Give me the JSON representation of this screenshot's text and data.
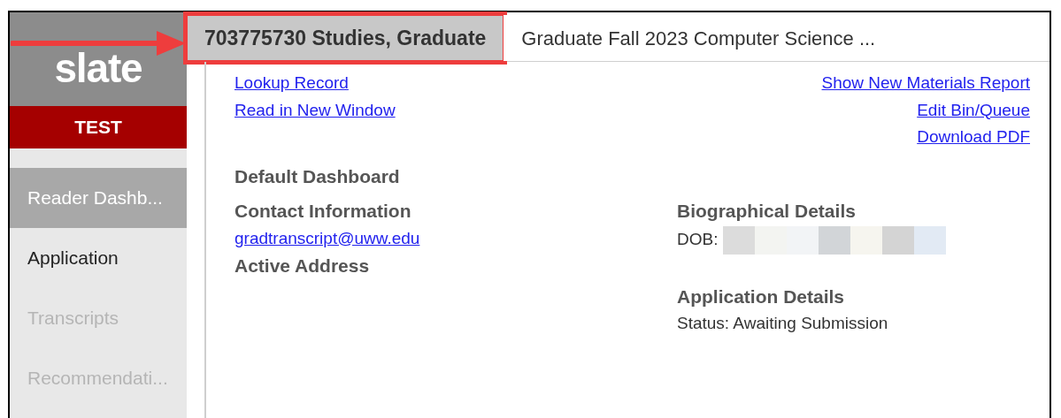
{
  "sidebar": {
    "logo": "slate",
    "badge": "TEST",
    "items": [
      {
        "label": "Reader Dashb...",
        "selected": true,
        "disabled": false
      },
      {
        "label": "Application",
        "selected": false,
        "disabled": false
      },
      {
        "label": "Transcripts",
        "selected": false,
        "disabled": true
      },
      {
        "label": "Recommendati...",
        "selected": false,
        "disabled": true
      }
    ]
  },
  "tabs": [
    {
      "label": "703775730 Studies, Graduate",
      "selected": true,
      "highlighted": true
    },
    {
      "label": "Graduate Fall 2023 Computer Science ...",
      "selected": false,
      "highlighted": false
    }
  ],
  "annotations": [
    {
      "kind": "arrow"
    }
  ],
  "links_left": [
    "Lookup Record",
    "Read in New Window"
  ],
  "links_right": [
    "Show New Materials Report",
    "Edit Bin/Queue",
    "Download PDF"
  ],
  "dashboard_title": "Default Dashboard",
  "left_column": [
    {
      "kind": "heading",
      "text": "Contact Information"
    },
    {
      "kind": "link",
      "text": "gradtranscript@uww.edu"
    },
    {
      "kind": "heading",
      "text": "Active Address"
    }
  ],
  "right_column": [
    {
      "kind": "heading",
      "text": "Biographical Details"
    },
    {
      "kind": "redacted",
      "text": "DOB:"
    },
    {
      "kind": "spacer"
    },
    {
      "kind": "heading",
      "text": "Application Details"
    },
    {
      "kind": "text",
      "text": "Status: Awaiting Submission"
    }
  ]
}
